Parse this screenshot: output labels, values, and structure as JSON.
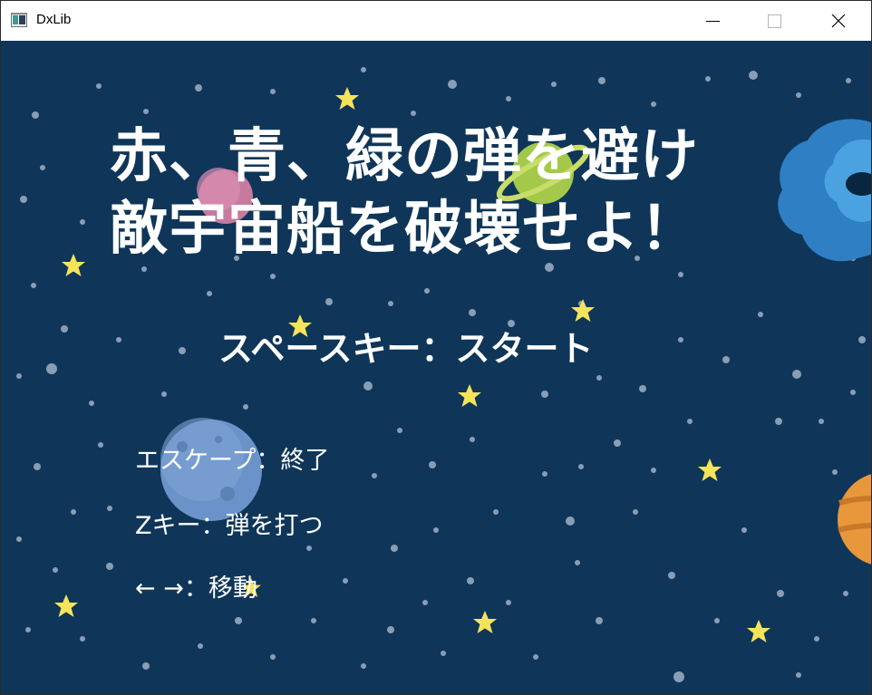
{
  "window": {
    "title": "DxLib",
    "icon": "dxlib-app-icon",
    "buttons": {
      "minimize": "minimize-icon",
      "maximize": "maximize-icon",
      "close": "close-icon"
    }
  },
  "game": {
    "headline_line1": "赤、青、緑の弾を避け",
    "headline_line2": "敵宇宙船を破壊せよ！",
    "start_prompt": "スペースキー：スタート",
    "controls": {
      "escape": "エスケープ：終了",
      "fire": "Zキー：弾を打つ",
      "move": "← →：移動"
    }
  },
  "colors": {
    "space_background": "#0f3659",
    "star_yellow": "#f5e35a",
    "dot_gray": "#9fb0c4",
    "text": "#ffffff"
  }
}
